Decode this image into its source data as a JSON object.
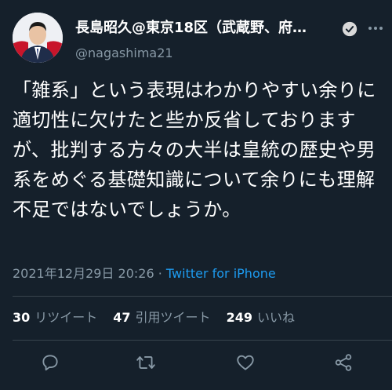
{
  "author": {
    "display_name": "長島昭久@東京18区（武蔵野、府…",
    "handle": "@nagashima21"
  },
  "tweet": {
    "text": "「雑系」という表現はわかりやすい余りに適切性に欠けたと些か反省しておりますが、批判する方々の大半は皇統の歴史や男系をめぐる基礎知識について余りにも理解不足ではないでしょうか。",
    "timestamp": "2021年12月29日 20:26",
    "separator": " · ",
    "source": "Twitter for iPhone"
  },
  "stats": {
    "retweets_count": "30",
    "retweets_label": "リツイート",
    "quotes_count": "47",
    "quotes_label": "引用ツイート",
    "likes_count": "249",
    "likes_label": "いいね"
  },
  "icons": {
    "verified": "verified-badge-icon",
    "more": "more-icon",
    "reply": "reply-icon",
    "retweet": "retweet-icon",
    "like": "heart-icon",
    "share": "share-icon"
  },
  "colors": {
    "background": "#15202b",
    "text": "#ffffff",
    "secondary": "#8899a6",
    "accent": "#1d9bf0",
    "divider": "#38444d"
  }
}
